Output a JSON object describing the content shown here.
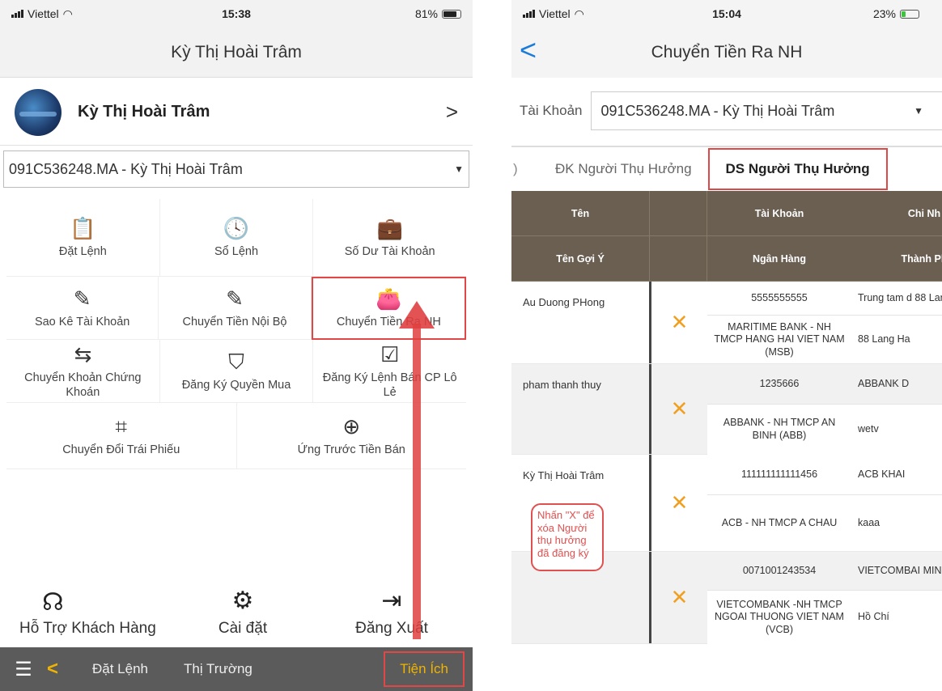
{
  "left": {
    "status": {
      "carrier": "Viettel",
      "time": "15:38",
      "battery": "81%"
    },
    "header": {
      "title": "Kỳ Thị Hoài Trâm"
    },
    "profile": {
      "name": "Kỳ Thị Hoài Trâm",
      "chevron": ">"
    },
    "account_select": {
      "value": "091C536248.MA - Kỳ Thị Hoài Trâm"
    },
    "menu": [
      {
        "label": "Đặt Lệnh",
        "icon": "clipboard-check-icon",
        "glyph": "📋"
      },
      {
        "label": "Sổ Lệnh",
        "icon": "clock-icon",
        "glyph": "🕓"
      },
      {
        "label": "Số Dư Tài Khoản",
        "icon": "briefcase-icon",
        "glyph": "💼"
      },
      {
        "label": "Sao Kê Tài Khoản",
        "icon": "edit-icon",
        "glyph": "✎"
      },
      {
        "label": "Chuyển Tiền Nội Bộ",
        "icon": "edit-icon",
        "glyph": "✎"
      },
      {
        "label": "Chuyển Tiền Ra NH",
        "icon": "wallet-icon",
        "glyph": "👛"
      },
      {
        "label": "Chuyển Khoản Chứng Khoán",
        "icon": "swap-arrows-icon",
        "glyph": "⇆"
      },
      {
        "label": "Đăng Ký Quyền Mua",
        "icon": "shield-check-icon",
        "glyph": "⛉"
      },
      {
        "label": "Đăng Ký Lệnh Bán CP Lô Lẻ",
        "icon": "clipboard-check-icon",
        "glyph": "☑"
      },
      {
        "label": "Chuyển Đổi Trái Phiếu",
        "icon": "crop-icon",
        "glyph": "⌗"
      },
      {
        "label": "Ứng Trước Tiền Bán",
        "icon": "lifebuoy-icon",
        "glyph": "⊕"
      }
    ],
    "bottom_actions": [
      {
        "label": "Hỗ Trợ Khách Hàng",
        "icon": "headset-icon",
        "glyph": "☊"
      },
      {
        "label": "Cài đặt",
        "icon": "gear-icon",
        "glyph": "⚙"
      },
      {
        "label": "Đăng Xuất",
        "icon": "logout-icon",
        "glyph": "⇥"
      }
    ],
    "tabbar": {
      "menu_glyph": "☰",
      "back_glyph": "<",
      "tab1": "Đặt Lệnh",
      "tab2": "Thị Trường",
      "tab3": "Tiện Ích"
    }
  },
  "right": {
    "status": {
      "carrier": "Viettel",
      "time": "15:04",
      "battery": "23%"
    },
    "header": {
      "title": "Chuyển Tiền Ra NH",
      "back_glyph": "<"
    },
    "account": {
      "label": "Tài Khoản",
      "value": "091C536248.MA - Kỳ Thị Hoài Trâm"
    },
    "tabs": {
      "partial": ")",
      "tab1": "ĐK Người Thụ Hưởng",
      "tab2": "DS Người Thụ Hưởng"
    },
    "table": {
      "headers_row1": {
        "c1": "Tên",
        "c3": "Tài Khoản",
        "c4": "Chi Nh"
      },
      "headers_row2": {
        "c1": "Tên Gợi Ý",
        "c3": "Ngân Hàng",
        "c4": "Thành Ph"
      },
      "rows": [
        {
          "name": "Au Duong PHong",
          "account": "5555555555",
          "branch": "Trung tam d 88 Lan",
          "bank": "MARITIME BANK - NH TMCP HANG HAI VIET NAM (MSB)",
          "city": "88 Lang Ha"
        },
        {
          "name": "pham thanh thuy",
          "account": "1235666",
          "branch": "ABBANK D",
          "bank": "ABBANK - NH TMCP AN BINH (ABB)",
          "city": "wetv"
        },
        {
          "name": "Kỳ Thị Hoài Trâm",
          "account": "111111111111456",
          "branch": "ACB KHAI",
          "bank": "ACB - NH TMCP A CHAU",
          "city": "kaaa"
        },
        {
          "name": "",
          "account": "0071001243534",
          "branch": "VIETCOMBAI MINH (",
          "bank": "VIETCOMBANK -NH TMCP NGOAI THUONG VIET NAM (VCB)",
          "city": "Hồ Chí"
        }
      ],
      "delete_glyph": "✕"
    },
    "callout": "Nhấn \"X\" để xóa Người thụ hưởng đã đăng ký"
  }
}
